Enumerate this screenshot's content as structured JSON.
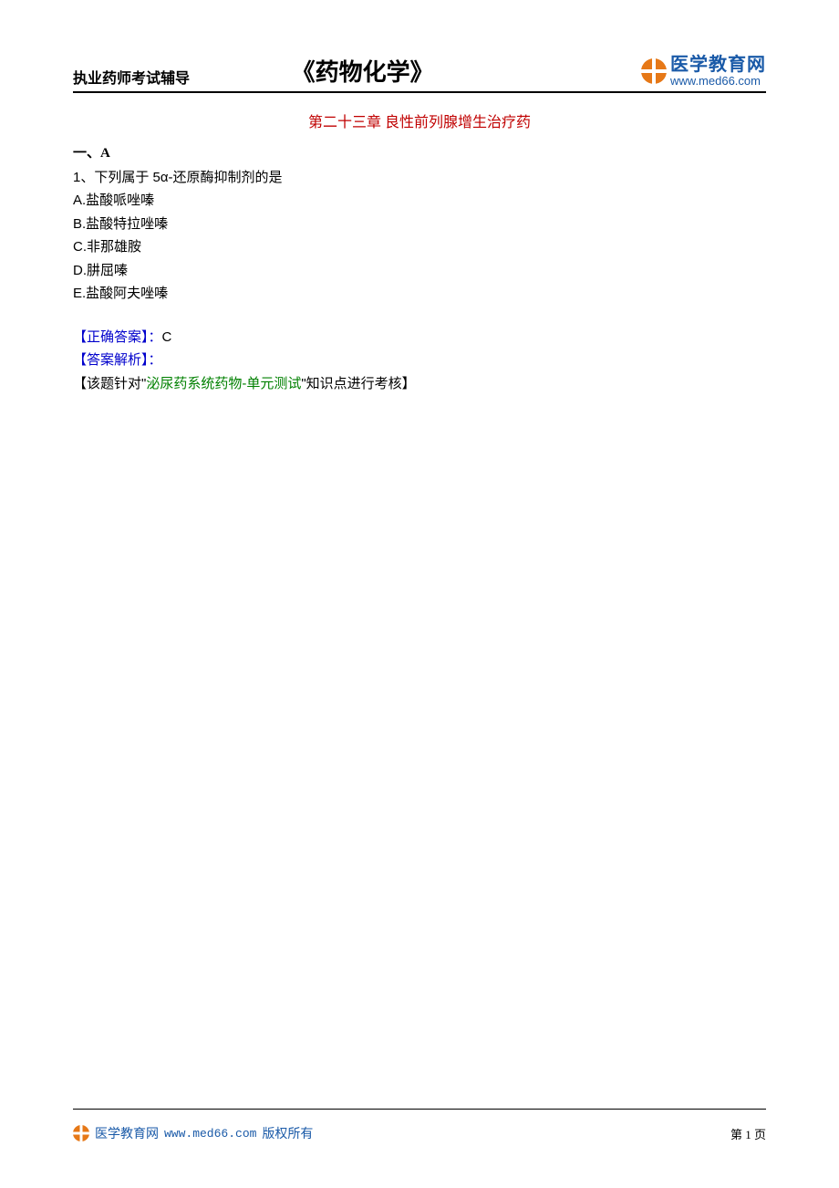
{
  "header": {
    "left": "执业药师考试辅导",
    "center": "《药物化学》",
    "logo_cn": "医学教育网",
    "logo_url": "www.med66.com"
  },
  "chapter": "第二十三章  良性前列腺增生治疗药",
  "section": "一、A",
  "question": {
    "number": "1、",
    "stem": "下列属于 5α-还原酶抑制剂的是",
    "options": {
      "A": "A.盐酸哌唑嗪",
      "B": "B.盐酸特拉唑嗪",
      "C": "C.非那雄胺",
      "D": "D.肼屈嗪",
      "E": "E.盐酸阿夫唑嗪"
    }
  },
  "answer": {
    "label": "【正确答案】：",
    "value": "C",
    "explain_label": "【答案解析】：",
    "explain_prefix": "【该题针对\"",
    "explain_green": "泌尿药系统药物-单元测试",
    "explain_suffix": "\"知识点进行考核】"
  },
  "footer": {
    "brand": "医学教育网",
    "url": "www.med66.com",
    "copyright": "版权所有",
    "page": "第 1 页"
  }
}
